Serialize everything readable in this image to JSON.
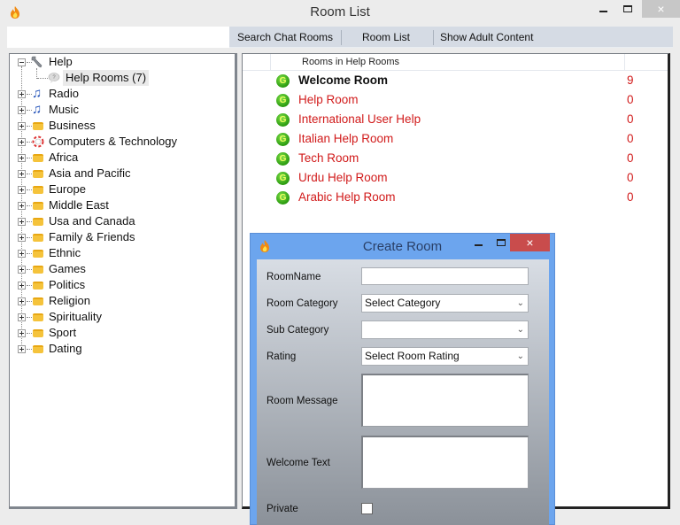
{
  "window": {
    "title": "Room List",
    "icon": "flame-icon",
    "controls": {
      "minimize": "minimize",
      "maximize": "maximize",
      "close": "×"
    }
  },
  "toolbar": {
    "search_value": "",
    "search_placeholder": "",
    "buttons": [
      "Search Chat Rooms",
      "Room List",
      "Show Adult Content"
    ]
  },
  "tree": {
    "root": {
      "label": "Help",
      "icon": "wrench-icon",
      "expanded": true,
      "children": [
        {
          "label": "Help Rooms (7)",
          "icon": "speech-bubble-icon",
          "selected": true
        }
      ]
    },
    "categories": [
      {
        "label": "Radio",
        "icon": "music-note-icon"
      },
      {
        "label": "Music",
        "icon": "music-note-icon"
      },
      {
        "label": "Business",
        "icon": "folder-icon"
      },
      {
        "label": "Computers & Technology",
        "icon": "lifebuoy-icon"
      },
      {
        "label": "Africa",
        "icon": "folder-icon"
      },
      {
        "label": "Asia and Pacific",
        "icon": "folder-icon"
      },
      {
        "label": "Europe",
        "icon": "folder-icon"
      },
      {
        "label": "Middle East",
        "icon": "folder-icon"
      },
      {
        "label": "Usa and Canada",
        "icon": "folder-icon"
      },
      {
        "label": "Family & Friends",
        "icon": "folder-icon"
      },
      {
        "label": "Ethnic",
        "icon": "folder-icon"
      },
      {
        "label": "Games",
        "icon": "folder-icon"
      },
      {
        "label": "Politics",
        "icon": "folder-icon"
      },
      {
        "label": "Religion",
        "icon": "folder-icon"
      },
      {
        "label": "Spirituality",
        "icon": "folder-icon"
      },
      {
        "label": "Sport",
        "icon": "folder-icon"
      },
      {
        "label": "Dating",
        "icon": "folder-icon"
      }
    ]
  },
  "rooms": {
    "header": "Rooms in Help Rooms",
    "items": [
      {
        "name": "Welcome Room",
        "count": "9",
        "bold": true
      },
      {
        "name": "Help Room",
        "count": "0"
      },
      {
        "name": "International User Help",
        "count": "0"
      },
      {
        "name": "Italian Help Room",
        "count": "0"
      },
      {
        "name": "Tech Room",
        "count": "0"
      },
      {
        "name": "Urdu Help Room",
        "count": "0"
      },
      {
        "name": "Arabic Help Room",
        "count": "0"
      }
    ],
    "icon_glyph": "G",
    "colors": {
      "room_name": "#d11a1a",
      "count": "#d11a1a"
    }
  },
  "dialog": {
    "title": "Create Room",
    "close_glyph": "×",
    "fields": {
      "room_name": {
        "label": "RoomName",
        "value": ""
      },
      "room_category": {
        "label": "Room Category",
        "value": "Select Category"
      },
      "sub_category": {
        "label": "Sub Category",
        "value": ""
      },
      "rating": {
        "label": "Rating",
        "value": "Select Room Rating"
      },
      "room_message": {
        "label": "Room Message",
        "value": ""
      },
      "welcome_text": {
        "label": "Welcome Text",
        "value": ""
      },
      "private": {
        "label": "Private",
        "checked": false
      }
    },
    "chevron_glyph": "⌄"
  }
}
